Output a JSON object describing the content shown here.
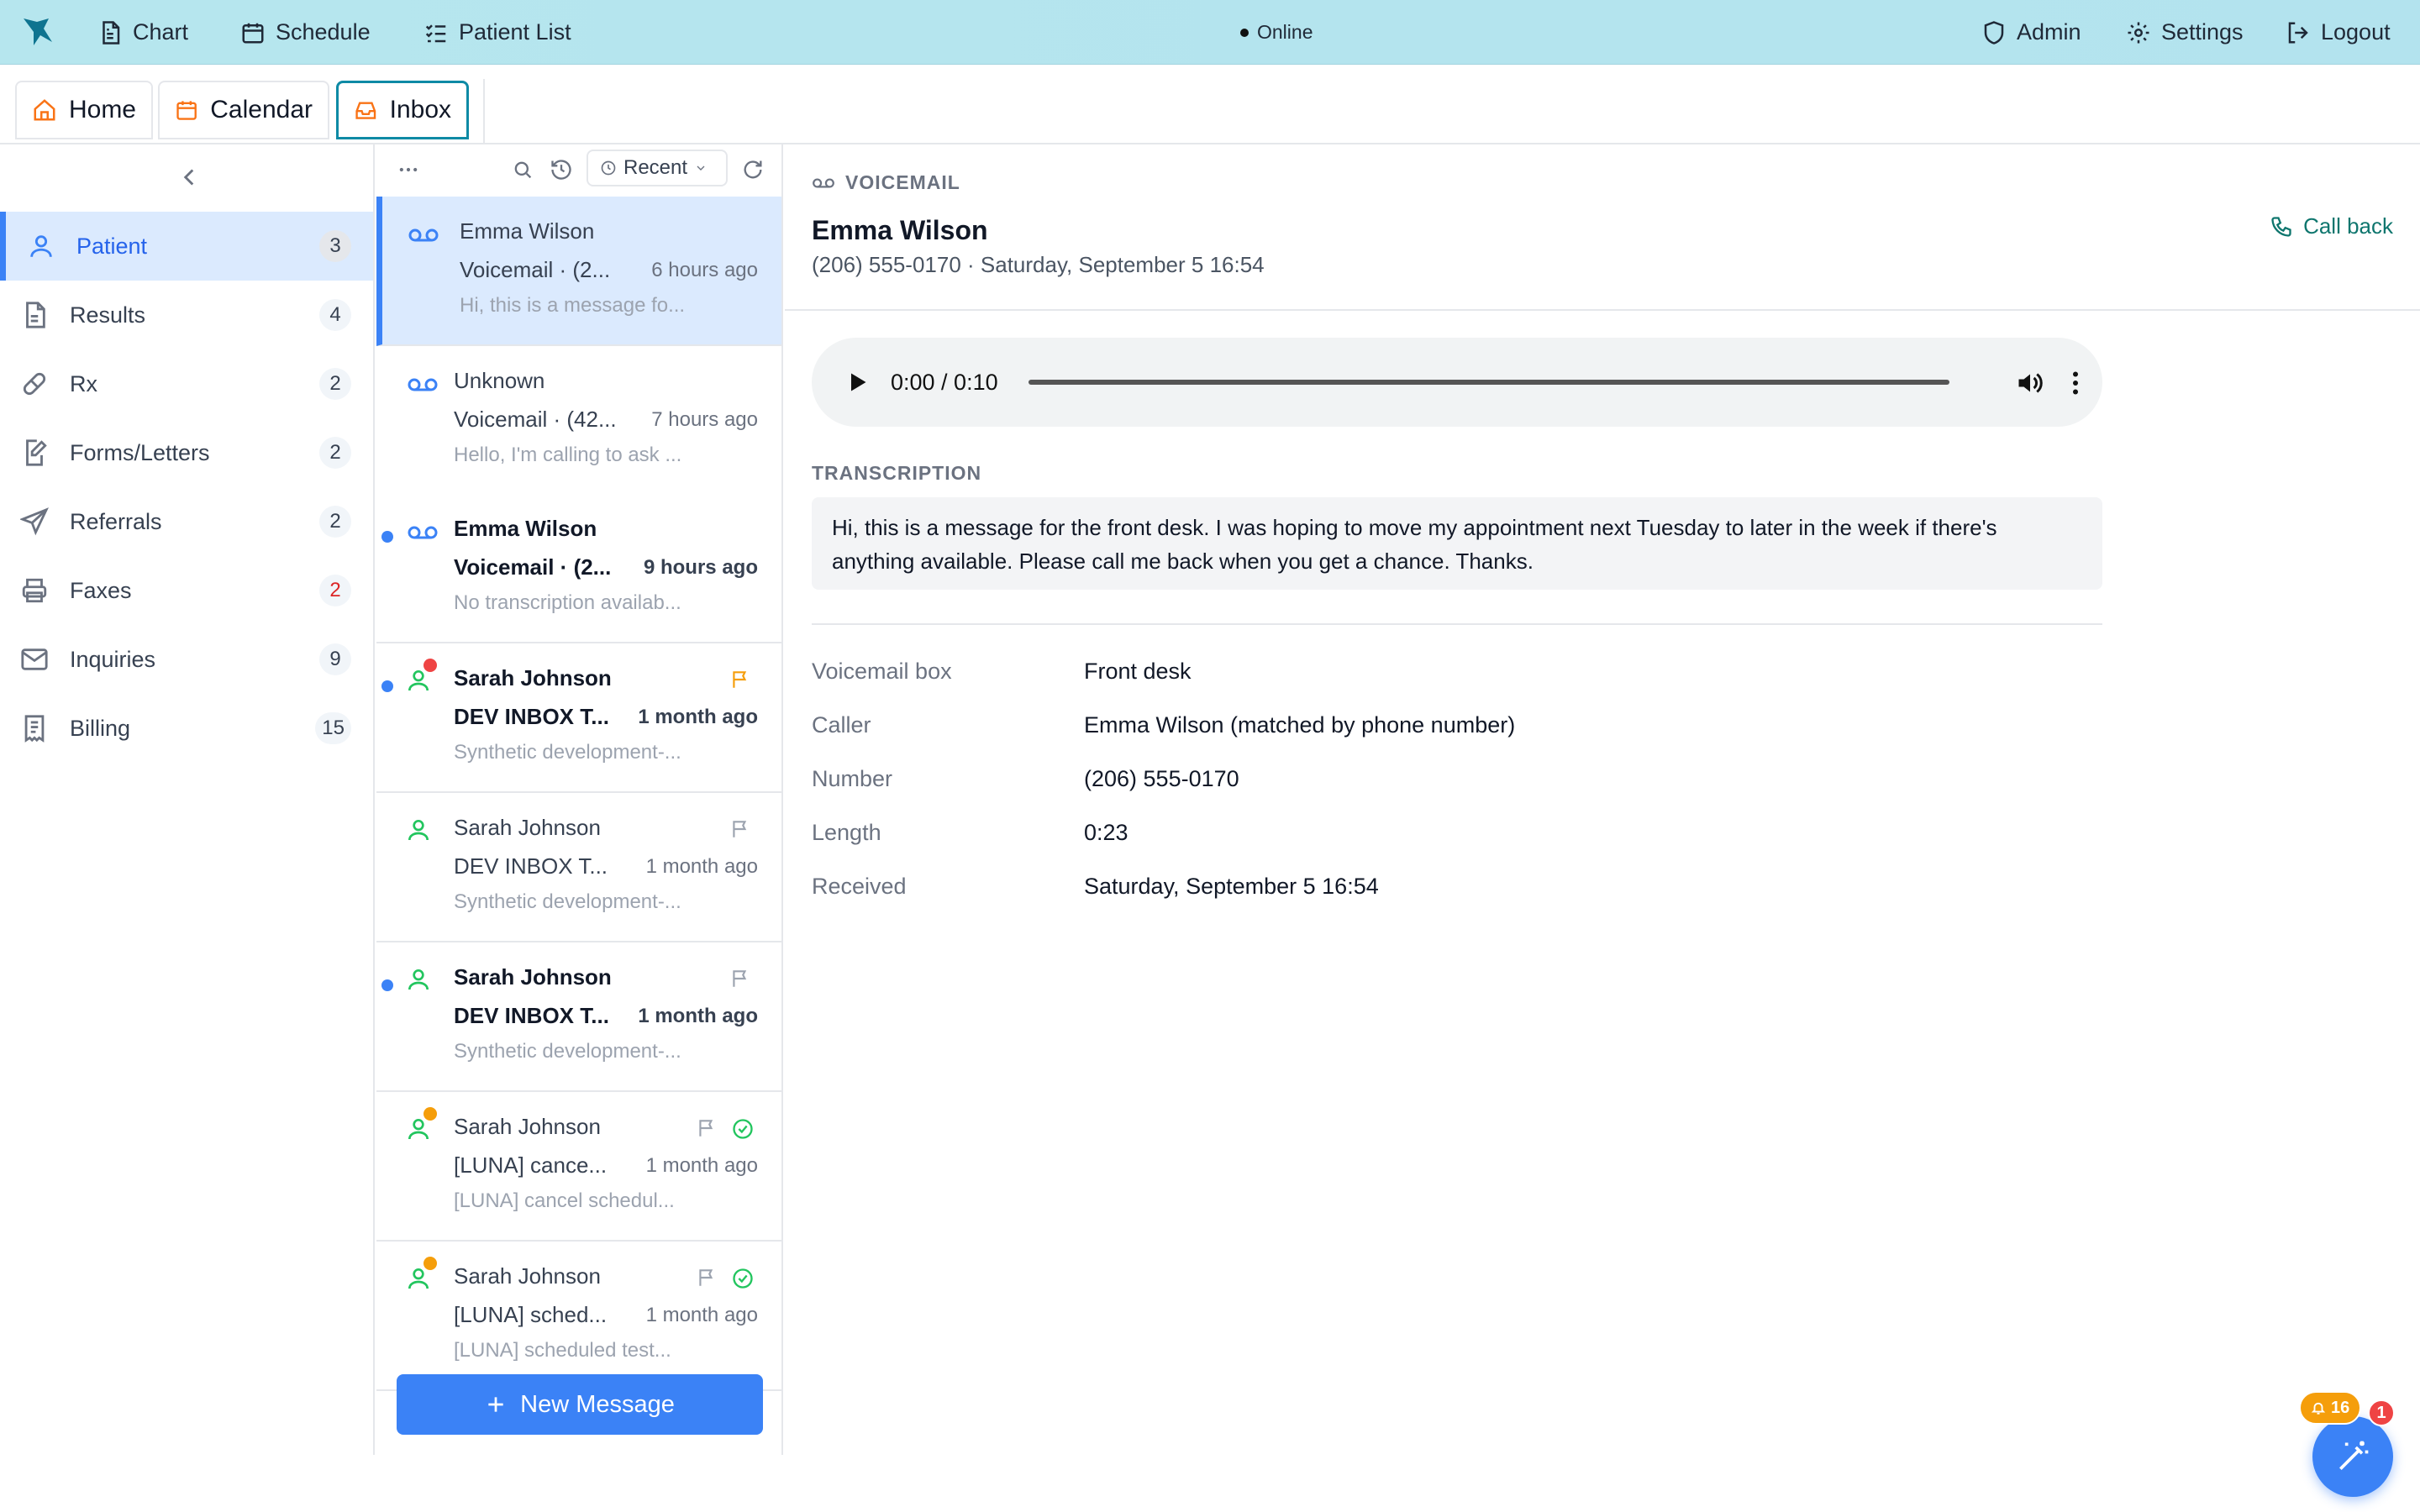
{
  "topnav": {
    "chart": "Chart",
    "schedule": "Schedule",
    "patient_list": "Patient List",
    "status": "Online",
    "admin": "Admin",
    "settings": "Settings",
    "logout": "Logout"
  },
  "tabs": {
    "home": "Home",
    "calendar": "Calendar",
    "inbox": "Inbox"
  },
  "sidebar": {
    "items": [
      {
        "label": "Patient",
        "count": "3",
        "icon": "user-icon"
      },
      {
        "label": "Results",
        "count": "4",
        "icon": "file-icon"
      },
      {
        "label": "Rx",
        "count": "2",
        "icon": "pill-icon"
      },
      {
        "label": "Forms/Letters",
        "count": "2",
        "icon": "form-edit-icon"
      },
      {
        "label": "Referrals",
        "count": "2",
        "icon": "send-icon"
      },
      {
        "label": "Faxes",
        "count": "2",
        "icon": "printer-icon"
      },
      {
        "label": "Inquiries",
        "count": "9",
        "icon": "mail-icon"
      },
      {
        "label": "Billing",
        "count": "15",
        "icon": "billing-icon"
      }
    ]
  },
  "list": {
    "filter": "Recent",
    "messages": [
      {
        "from": "Emma Wilson",
        "subject": "Voicemail · (2...",
        "time": "6 hours ago",
        "preview": "Hi, this is a message fo..."
      },
      {
        "from": "Unknown",
        "subject": "Voicemail · (42...",
        "time": "7 hours ago",
        "preview": "Hello, I'm calling to ask ..."
      },
      {
        "from": "Emma Wilson",
        "subject": "Voicemail · (2...",
        "time": "9 hours ago",
        "preview": "No transcription availab..."
      },
      {
        "from": "Sarah Johnson",
        "subject": "DEV INBOX T...",
        "time": "1 month ago",
        "preview": "Synthetic development-..."
      },
      {
        "from": "Sarah Johnson",
        "subject": "DEV INBOX T...",
        "time": "1 month ago",
        "preview": "Synthetic development-..."
      },
      {
        "from": "Sarah Johnson",
        "subject": "DEV INBOX T...",
        "time": "1 month ago",
        "preview": "Synthetic development-..."
      },
      {
        "from": "Sarah Johnson",
        "subject": "[LUNA] cance...",
        "time": "1 month ago",
        "preview": "[LUNA] cancel schedul..."
      },
      {
        "from": "Sarah Johnson",
        "subject": "[LUNA] sched...",
        "time": "1 month ago",
        "preview": "[LUNA] scheduled test..."
      }
    ],
    "new_message": "New Message"
  },
  "detail": {
    "type_label": "VOICEMAIL",
    "title": "Emma Wilson",
    "subtitle": "(206) 555-0170 · Saturday, September 5 16:54",
    "call_back": "Call back",
    "player_time": "0:00 / 0:10",
    "transcription_label": "TRANSCRIPTION",
    "transcription": "Hi, this is a message for the front desk. I was hoping to move my appointment next Tuesday to later in the week if there's anything available. Please call me back when you get a chance. Thanks.",
    "fields": [
      {
        "key": "Voicemail box",
        "value": "Front desk"
      },
      {
        "key": "Caller",
        "value": "Emma Wilson (matched by phone number)"
      },
      {
        "key": "Number",
        "value": "(206) 555-0170"
      },
      {
        "key": "Length",
        "value": "0:23"
      },
      {
        "key": "Received",
        "value": "Saturday, September 5 16:54"
      }
    ]
  },
  "badges": {
    "notifications": "16",
    "alerts": "1"
  },
  "colors": {
    "accent": "#3b82f6",
    "topbar": "#b6e6ee",
    "tab_active_border": "#0e8aa5",
    "callback": "#0f766e"
  }
}
